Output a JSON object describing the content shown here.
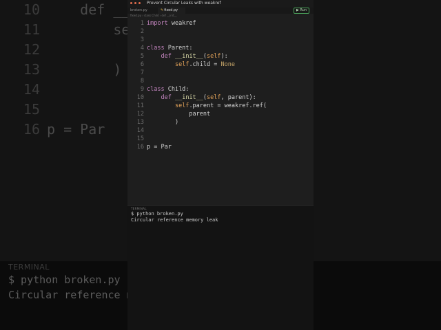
{
  "window": {
    "title": "Prevent Circular Leaks with weakref",
    "run_label": "Run"
  },
  "tabs": [
    {
      "label": "broken.py",
      "active": false
    },
    {
      "label": "fixed.py",
      "active": true,
      "modified_mark": "✎"
    }
  ],
  "breadcrumb": "fixed.py › class Child › def __init__",
  "editor": {
    "lines": [
      {
        "n": "1",
        "text": "import weakref"
      },
      {
        "n": "2",
        "text": ""
      },
      {
        "n": "3",
        "text": ""
      },
      {
        "n": "4",
        "text": "class Parent:"
      },
      {
        "n": "5",
        "text": "    def __init__(self):"
      },
      {
        "n": "6",
        "text": "        self.child = None"
      },
      {
        "n": "7",
        "text": ""
      },
      {
        "n": "8",
        "text": ""
      },
      {
        "n": "9",
        "text": "class Child:"
      },
      {
        "n": "10",
        "text": "    def __init__(self, parent):"
      },
      {
        "n": "11",
        "text": "        self.parent = weakref.ref("
      },
      {
        "n": "12",
        "text": "            parent"
      },
      {
        "n": "13",
        "text": "        )"
      },
      {
        "n": "14",
        "text": ""
      },
      {
        "n": "15",
        "text": ""
      },
      {
        "n": "16",
        "text": "p = Par"
      }
    ]
  },
  "terminal": {
    "title": "TERMINAL",
    "lines": [
      "$ python broken.py",
      "Circular reference memory leak"
    ]
  },
  "background": {
    "code_lines": [
      {
        "n": "10",
        "text": "    def __i"
      },
      {
        "n": "11",
        "text": "        self"
      },
      {
        "n": "12",
        "text": ""
      },
      {
        "n": "13",
        "text": "        )"
      },
      {
        "n": "14",
        "text": ""
      },
      {
        "n": "15",
        "text": ""
      },
      {
        "n": "16",
        "text": "p = Par"
      }
    ],
    "terminal_title": "TERMINAL",
    "terminal_lines": [
      "$ python broken.py",
      "Circular reference m"
    ]
  },
  "colors": {
    "keyword": "#c586c0",
    "self": "#e5a45a",
    "function": "#dcdcaa",
    "run_border": "#4aa35a",
    "dot": "#e06c4c"
  }
}
